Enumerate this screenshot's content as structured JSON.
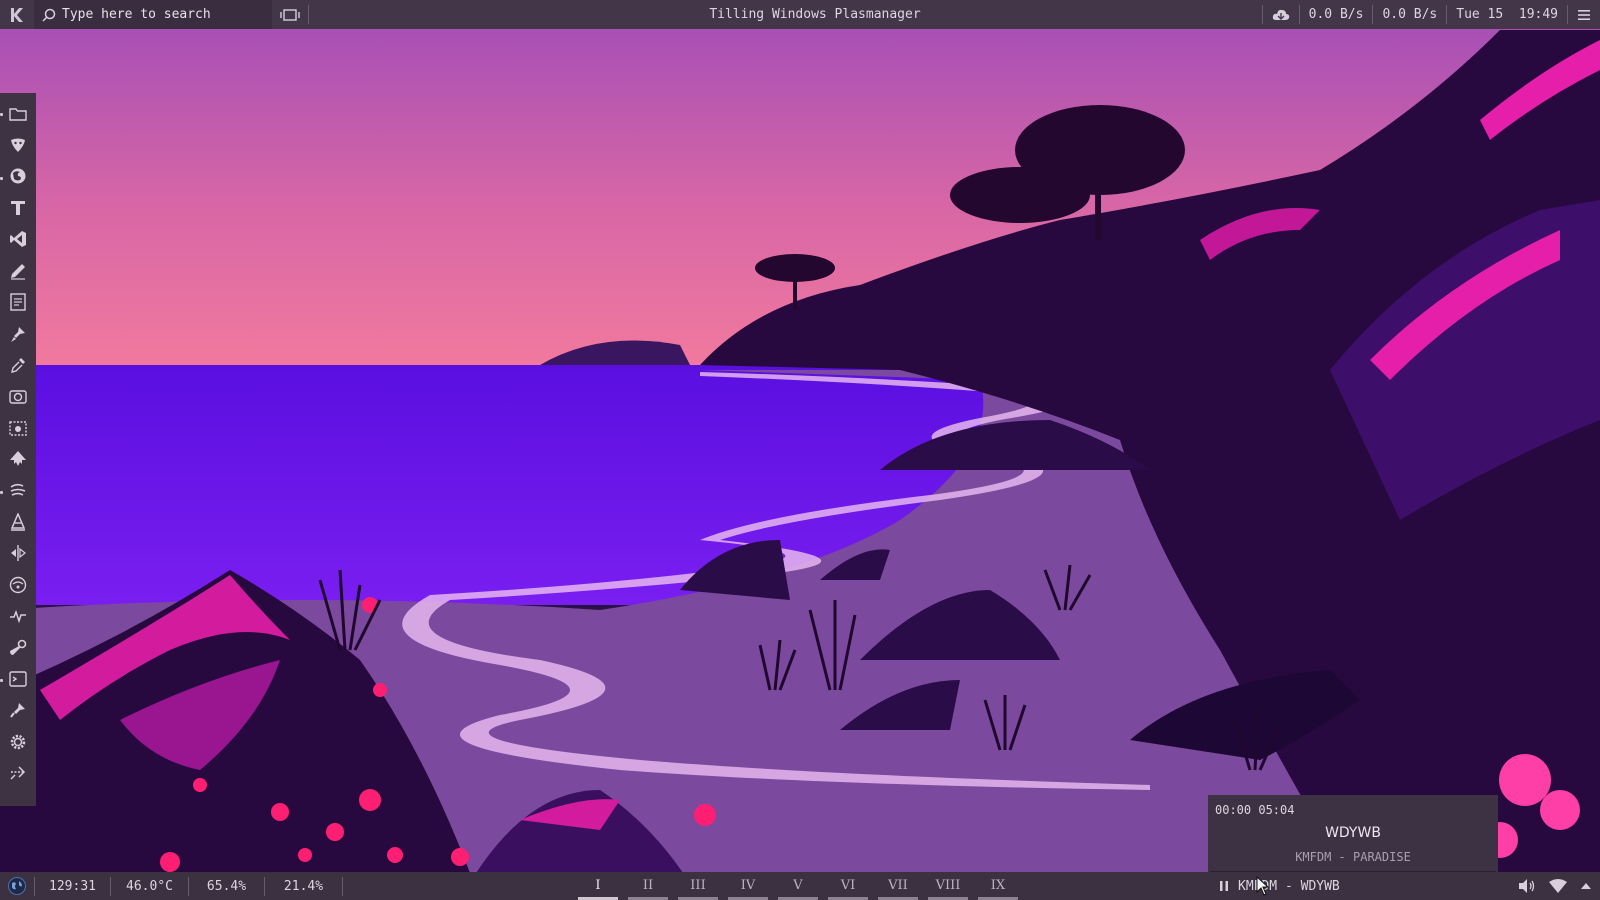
{
  "topbar": {
    "search_placeholder": "Type here to search",
    "window_title": "Tilling Windows Plasmanager",
    "net_down": "0.0 B/s",
    "net_up": "0.0 B/s",
    "datetime": "Tue 15  19:49"
  },
  "dock": {
    "items": [
      "folder-icon",
      "dragon-icon",
      "firefox-icon",
      "text-editor-icon",
      "vscode-icon",
      "pen-icon",
      "notes-icon",
      "brush-icon",
      "color-picker-icon",
      "camera-icon",
      "screenshot-icon",
      "inkscape-icon",
      "wind-icon",
      "vlc-icon",
      "mirror-icon",
      "disk-icon",
      "activity-icon",
      "steam-icon",
      "terminal-icon",
      "tool-icon",
      "settings-icon",
      "arrows-icon"
    ]
  },
  "media_popup": {
    "elapsed": "00:00",
    "duration": "05:04",
    "title": "WDYWB",
    "subtitle": "KMFDM - PARADISE",
    "progress": 0.0
  },
  "bottombar": {
    "uptime": "129:31",
    "temperature": "46.0°C",
    "memory": "65.4%",
    "cpu": "21.4%",
    "workspaces": [
      "I",
      "II",
      "III",
      "IV",
      "V",
      "VI",
      "VII",
      "VIII",
      "IX"
    ],
    "active_workspace": "I",
    "now_playing": "KMFDM - WDYWB"
  },
  "colors": {
    "sky_top": "#a248b8",
    "sky_bottom": "#f07aa8",
    "sea": "#6a0fe6",
    "sand": "#7a4a9c",
    "cliff_dark": "#24093f",
    "cliff_pink": "#e21fa8",
    "bar_bg": "#443649"
  }
}
